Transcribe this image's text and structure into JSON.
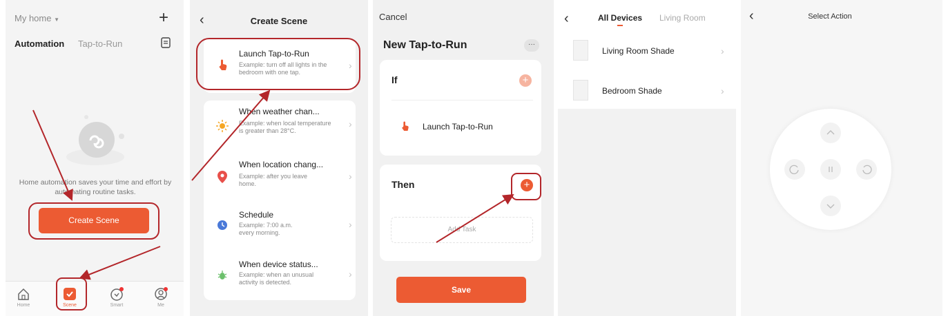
{
  "home": {
    "home_selector": "My home",
    "tabs": [
      "Automation",
      "Tap-to-Run"
    ],
    "empty_message": "Home automation saves your time and effort by automating routine tasks.",
    "create_button": "Create Scene",
    "bottom_nav": [
      "Home",
      "Scene",
      "Smart",
      "Me"
    ]
  },
  "create_scene": {
    "title": "Create Scene",
    "options": [
      {
        "title": "Launch Tap-to-Run",
        "desc": "Example: turn off all lights in the bedroom with one tap.",
        "icon": "hand-tap-icon"
      },
      {
        "title": "When weather chan...",
        "desc": "Example: when local temperature is greater than 28°C.",
        "icon": "sun-icon"
      },
      {
        "title": "When location chang...",
        "desc": "Example: after you leave home.",
        "icon": "location-pin-icon"
      },
      {
        "title": "Schedule",
        "desc": "Example: 7:00 a.m. every morning.",
        "icon": "clock-icon"
      },
      {
        "title": "When device status...",
        "desc": "Example: when an unusual activity is detected.",
        "icon": "device-bug-icon"
      }
    ]
  },
  "new_tap": {
    "cancel": "Cancel",
    "title": "New Tap-to-Run",
    "more": "···",
    "if_label": "If",
    "condition": "Launch Tap-to-Run",
    "then_label": "Then",
    "add_task": "Add Task",
    "save": "Save"
  },
  "devices": {
    "tabs": [
      "All Devices",
      "Living Room"
    ],
    "items": [
      "Living Room Shade",
      "Bedroom Shade"
    ]
  },
  "action": {
    "title": "Select Action"
  },
  "colors": {
    "accent": "#ec5b33",
    "annotation": "#b3262a"
  }
}
